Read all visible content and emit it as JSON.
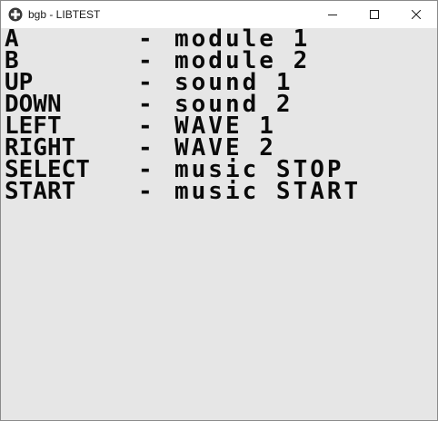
{
  "window": {
    "title": "bgb - LIBTEST",
    "app_icon": "gamepad-cross-icon",
    "controls": {
      "minimize_icon": "minimize-icon",
      "maximize_icon": "maximize-icon",
      "close_icon": "close-icon"
    }
  },
  "screen": {
    "background": "#e6e6e6",
    "text_color": "#0a0a0a",
    "lines": [
      {
        "key": "A",
        "sep": "-",
        "action": "module 1"
      },
      {
        "key": "B",
        "sep": "-",
        "action": "module 2"
      },
      {
        "key": "UP",
        "sep": "-",
        "action": "sound 1"
      },
      {
        "key": "DOWN",
        "sep": "-",
        "action": "sound 2"
      },
      {
        "key": "LEFT",
        "sep": "-",
        "action": "WAVE 1"
      },
      {
        "key": "RIGHT",
        "sep": "-",
        "action": "WAVE 2"
      },
      {
        "key": "SELECT",
        "sep": "-",
        "action": "music STOP"
      },
      {
        "key": "START",
        "sep": "-",
        "action": "music START"
      }
    ]
  }
}
